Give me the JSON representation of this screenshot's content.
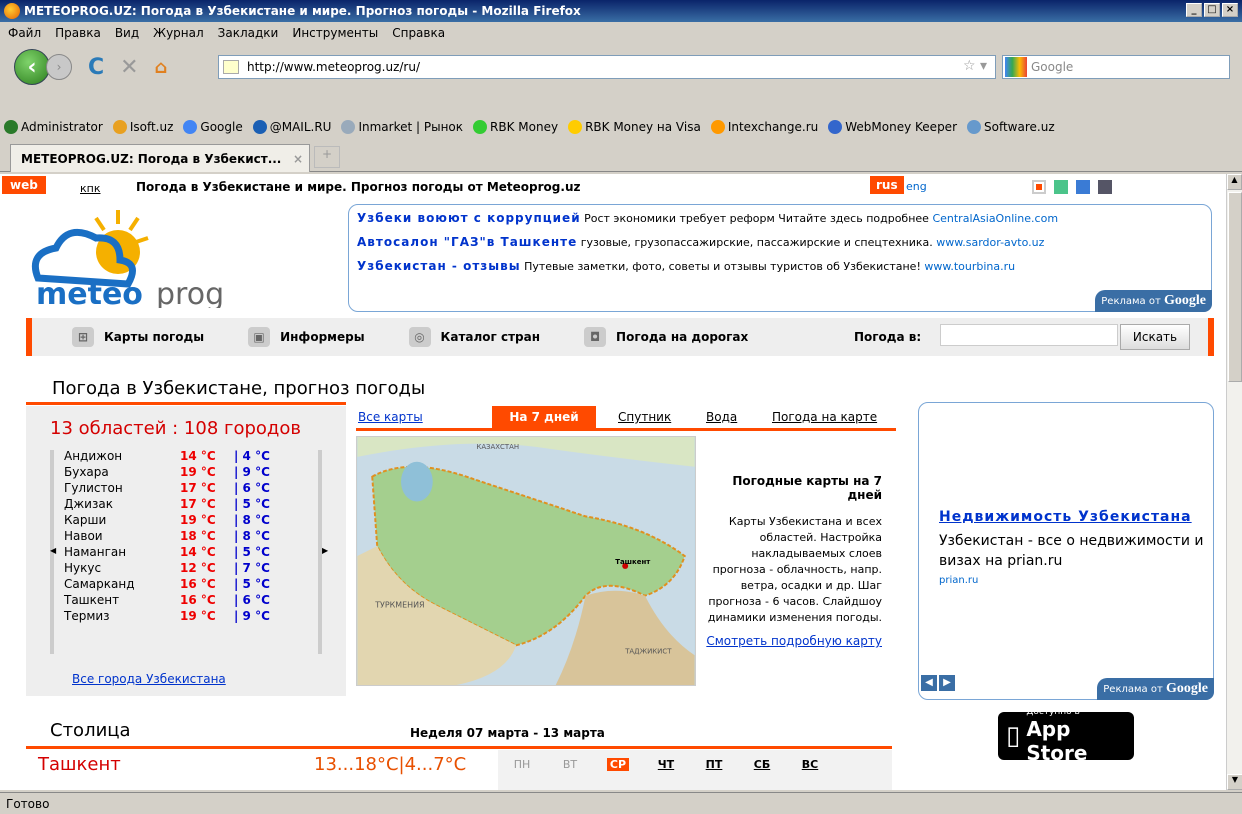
{
  "window": {
    "title": "METEOPROG.UZ: Погода в Узбекистане и мире. Прогноз погоды - Mozilla Firefox"
  },
  "menubar": [
    "Файл",
    "Правка",
    "Вид",
    "Журнал",
    "Закладки",
    "Инструменты",
    "Справка"
  ],
  "nav": {
    "url": "http://www.meteoprog.uz/ru/",
    "search_placeholder": "Google"
  },
  "bookmarks": [
    "Administrator",
    "Isoft.uz",
    "Google",
    "@MAIL.RU",
    "Inmarket | Рынок",
    "RBK Money",
    "RBK Money на Visa",
    "Intexchange.ru",
    "WebMoney Keeper",
    "Software.uz"
  ],
  "tab": {
    "title": "METEOPROG.UZ: Погода в Узбекист..."
  },
  "status": "Готово",
  "page": {
    "web": "web",
    "kpk": "кпк",
    "headline": "Погода в Узбекистане и мире. Прогноз погоды от Meteoprog.uz",
    "rus": "rus",
    "eng": "eng",
    "ads": [
      {
        "title": "Узбеки воюют с коррупцией",
        "text": "Рост экономики требует реформ Читайте здесь подробнее",
        "url": "CentralAsiaOnline.com"
      },
      {
        "title": "Автосалон \"ГАЗ\"в Ташкенте",
        "text": "гузовые, грузопассажирские, пассажирские и спецтехника.",
        "url": "www.sardor-avto.uz"
      },
      {
        "title": "Узбекистан - отзывы",
        "text": "Путевые заметки, фото, советы и отзывы туристов об Узбекистане!",
        "url": "www.tourbina.ru"
      }
    ],
    "ads_tag": "Реклама от",
    "google": "Google",
    "menu": [
      "Карты погоды",
      "Информеры",
      "Каталог стран",
      "Погода на дорогах"
    ],
    "weather_in": "Погода в:",
    "search_btn": "Искать",
    "h1": "Погода в Узбекистане, прогноз погоды",
    "regions": "13 областей : 108 городов",
    "cities": [
      {
        "name": "Андижон",
        "day": "14 °C",
        "night": "| 4 °C"
      },
      {
        "name": "Бухара",
        "day": "19 °C",
        "night": "| 9 °C"
      },
      {
        "name": "Гулистон",
        "day": "17 °C",
        "night": "| 6 °C"
      },
      {
        "name": "Джизак",
        "day": "17 °C",
        "night": "| 5 °C"
      },
      {
        "name": "Карши",
        "day": "19 °C",
        "night": "| 8 °C"
      },
      {
        "name": "Навои",
        "day": "18 °C",
        "night": "| 8 °C"
      },
      {
        "name": "Наманган",
        "day": "14 °C",
        "night": "| 5 °C"
      },
      {
        "name": "Нукус",
        "day": "12 °C",
        "night": "| 7 °C"
      },
      {
        "name": "Самарканд",
        "day": "16 °C",
        "night": "| 5 °C"
      },
      {
        "name": "Ташкент",
        "day": "16 °C",
        "night": "| 6 °C"
      },
      {
        "name": "Термиз",
        "day": "19 °C",
        "night": "| 9 °C"
      }
    ],
    "all_cities": "Все города Узбекистана",
    "map_tabs": {
      "all": "Все карты",
      "week": "На 7 дней",
      "sat": "Спутник",
      "water": "Вода",
      "onmap": "Погода на карте"
    },
    "map_title": "Погодные карты на 7 дней",
    "map_text": "Карты Узбекистана и всех областей. Настройка накладываемых слоев прогноза - облачность, напр. ветра, осадки и др. Шаг прогноза - 6 часов. Слайдшоу динамики изменения погоды.",
    "map_link": "Смотреть подробную карту",
    "map_labels": {
      "kz": "КАЗАХСТАН",
      "tm": "ТУРКМЕНИЯ",
      "tj": "ТАДЖИКИСТ",
      "tash": "Ташкент"
    },
    "side_ad": {
      "title": "Недвижимость Узбекистана",
      "desc": "Узбекистан - все о недвижимости и визах на prian.ru",
      "url": "prian.ru"
    },
    "appstore": {
      "small": "Доступно в",
      "big": "App Store"
    },
    "capital": "Столица",
    "week": "Неделя 07 марта - 13 марта",
    "tashkent": "Ташкент",
    "tashkent_temp": "13...18°C|4...7°C",
    "days": [
      "ПН",
      "ВТ",
      "СР",
      "ЧТ",
      "ПТ",
      "СБ",
      "ВС"
    ],
    "colors": {
      "accent": "#ff4a00",
      "link": "#0033cc",
      "temp_day": "#ee0000",
      "temp_night": "#0000cc"
    }
  }
}
